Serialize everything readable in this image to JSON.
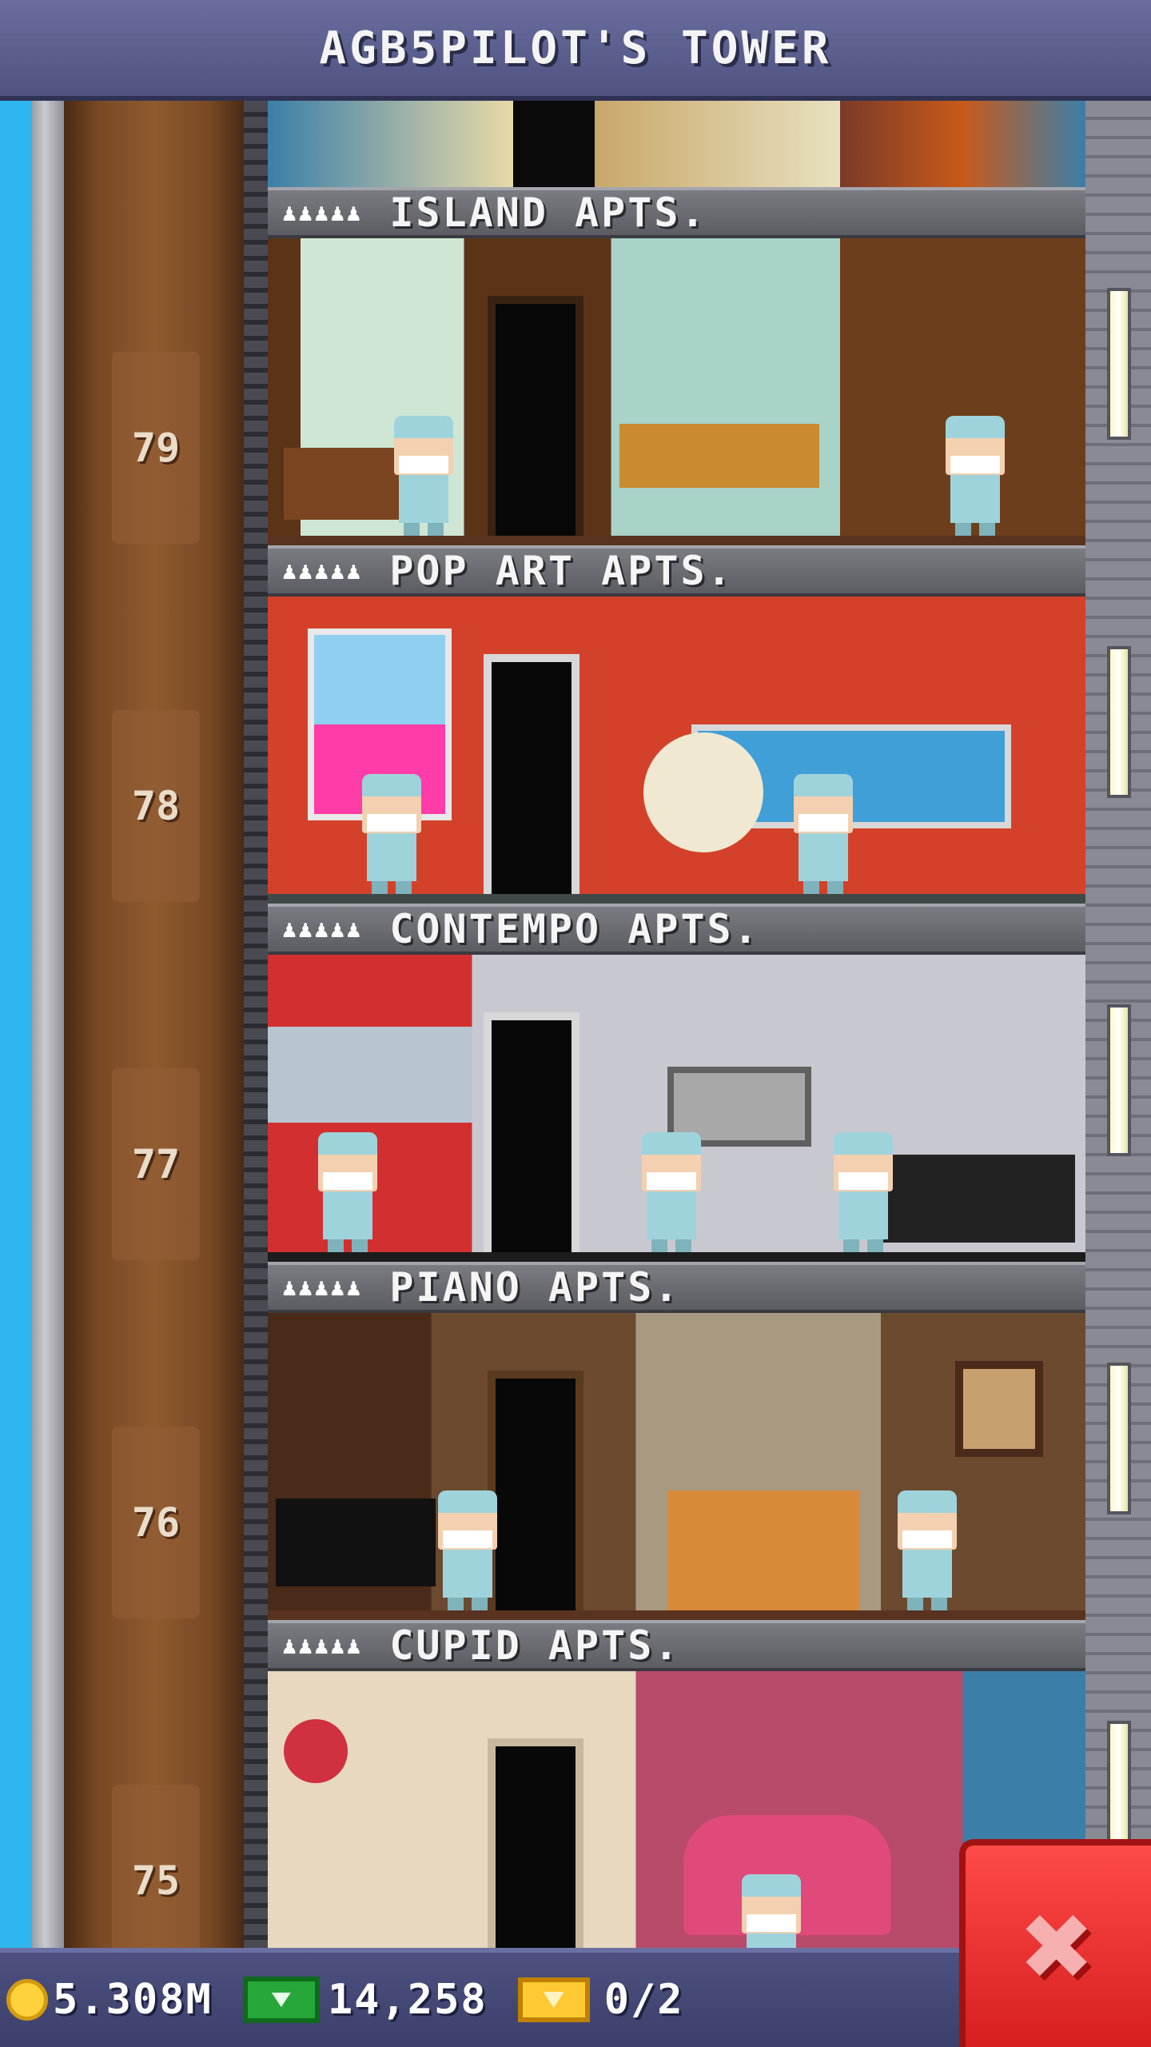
{
  "header": {
    "title": "AGB5PILOT'S TOWER"
  },
  "floors": [
    {
      "number": "79",
      "name": "ISLAND APTS.",
      "residents": "♟♟♟♟♟"
    },
    {
      "number": "78",
      "name": "POP ART APTS.",
      "residents": "♟♟♟♟♟"
    },
    {
      "number": "77",
      "name": "CONTEMPO APTS.",
      "residents": "♟♟♟♟♟"
    },
    {
      "number": "76",
      "name": "PIANO APTS.",
      "residents": "♟♟♟♟♟"
    },
    {
      "number": "75",
      "name": "CUPID APTS.",
      "residents": "♟♟♟♟♟"
    }
  ],
  "hud": {
    "coins": "5.308M",
    "coins_icon": "coin-icon",
    "bux": "14,258",
    "bux_icon": "tower-bux-icon",
    "tickets": "0/2",
    "tickets_icon": "golden-ticket-icon"
  },
  "close_button": {
    "label": "✖",
    "icon": "close-icon"
  },
  "colors": {
    "close": "#e02828",
    "hud": "#474b78",
    "title_bar": "#5c6090"
  }
}
